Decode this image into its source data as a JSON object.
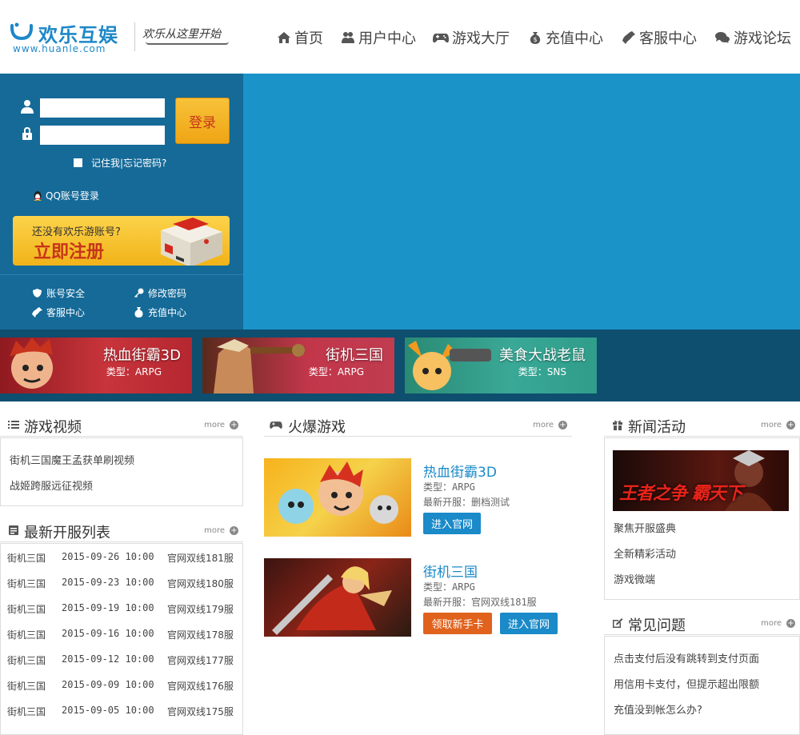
{
  "header": {
    "logo_name": "欢乐互娱",
    "logo_url": "www.huanle.com",
    "slogan": "欢乐从这里开始",
    "nav": [
      {
        "label": "首页",
        "icon": "home-icon"
      },
      {
        "label": "用户中心",
        "icon": "users-icon"
      },
      {
        "label": "游戏大厅",
        "icon": "gamepad-icon"
      },
      {
        "label": "充值中心",
        "icon": "money-bag-icon"
      },
      {
        "label": "客服中心",
        "icon": "phone-icon"
      },
      {
        "label": "游戏论坛",
        "icon": "chat-bubbles-icon"
      }
    ]
  },
  "login": {
    "username_value": "",
    "password_value": "",
    "login_button": "登录",
    "remember_text": "记住我|忘记密码?",
    "qq_login": "QQ账号登录",
    "register_prompt": "还没有欢乐游账号?",
    "register_button": "立即注册",
    "quick_links": [
      {
        "label": "账号安全",
        "icon": "shield-icon"
      },
      {
        "label": "修改密码",
        "icon": "key-icon"
      },
      {
        "label": "客服中心",
        "icon": "phone-icon"
      },
      {
        "label": "充值中心",
        "icon": "money-bag-icon"
      }
    ]
  },
  "game_cards": [
    {
      "title": "热血街霸3D",
      "type": "类型：ARPG"
    },
    {
      "title": "街机三国",
      "type": "类型：ARPG"
    },
    {
      "title": "美食大战老鼠",
      "type": "类型：SNS"
    }
  ],
  "more_label": "more",
  "videos": {
    "title": "游戏视频",
    "items": [
      "街机三国魔王孟获单刷视频",
      "战姬跨服远征视频"
    ]
  },
  "servers": {
    "title": "最新开服列表",
    "rows": [
      {
        "game": "街机三国",
        "time": "2015-09-26 10:00",
        "server": "官网双线181服"
      },
      {
        "game": "街机三国",
        "time": "2015-09-23 10:00",
        "server": "官网双线180服"
      },
      {
        "game": "街机三国",
        "time": "2015-09-19 10:00",
        "server": "官网双线179服"
      },
      {
        "game": "街机三国",
        "time": "2015-09-16 10:00",
        "server": "官网双线178服"
      },
      {
        "game": "街机三国",
        "time": "2015-09-12 10:00",
        "server": "官网双线177服"
      },
      {
        "game": "街机三国",
        "time": "2015-09-09 10:00",
        "server": "官网双线176服"
      },
      {
        "game": "街机三国",
        "time": "2015-09-05 10:00",
        "server": "官网双线175服"
      }
    ]
  },
  "hot": {
    "title": "火爆游戏",
    "games": [
      {
        "title": "热血街霸3D",
        "type": "类型：ARPG",
        "latest": "最新开服：删档测试",
        "buttons": [
          "进入官网"
        ]
      },
      {
        "title": "街机三国",
        "type": "类型：ARPG",
        "latest": "最新开服：官网双线181服",
        "buttons": [
          "领取新手卡",
          "进入官网"
        ]
      }
    ]
  },
  "news": {
    "title": "新闻活动",
    "banner_text": "王者之争 霸天下",
    "items": [
      "聚焦开服盛典",
      "全新精彩活动",
      "游戏微端"
    ]
  },
  "faq": {
    "title": "常见问题",
    "items": [
      "点击支付后没有跳转到支付页面",
      "用信用卡支付，但提示超出限额",
      "充值没到帐怎么办?"
    ]
  },
  "colors": {
    "brand_blue": "#1a93c9",
    "login_panel": "#156a98",
    "strip": "#0e4e6e",
    "accent_orange": "#f1b319",
    "link_blue": "#1a8ac8"
  }
}
